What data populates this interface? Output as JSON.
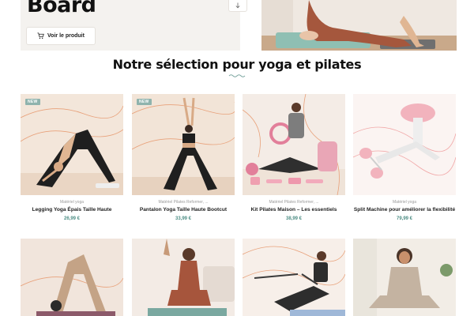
{
  "hero": {
    "title": "Board",
    "button_label": "Voir le produit",
    "button_icon": "cart-icon",
    "arrow_icon": "arrow-down-icon"
  },
  "section": {
    "title": "Notre sélection pour yoga et pilates",
    "divider_icon": "squiggle-icon"
  },
  "products": [
    {
      "badge": "NEW",
      "category": "Matériel yoga",
      "name": "Legging Yoga Épais Taille Haute",
      "price": "26,99 €"
    },
    {
      "badge": "NEW",
      "category": "Matériel Pilates Reformer, ...",
      "name": "Pantalon Yoga Taille Haute Bootcut",
      "price": "33,99 €"
    },
    {
      "badge": "",
      "category": "Matériel Pilates Reformer, ...",
      "name": "Kit Pilates Maison – Les essentiels",
      "price": "38,99 €"
    },
    {
      "badge": "",
      "category": "Matériel yoga",
      "name": "Split Machine pour améliorer la flexibilité",
      "price": "79,99 €"
    }
  ],
  "colors": {
    "accent": "#4f8f86",
    "badge": "#8fb3ad",
    "card_bg_warm": "#f3e6da",
    "line_art": "#e8a17a"
  }
}
